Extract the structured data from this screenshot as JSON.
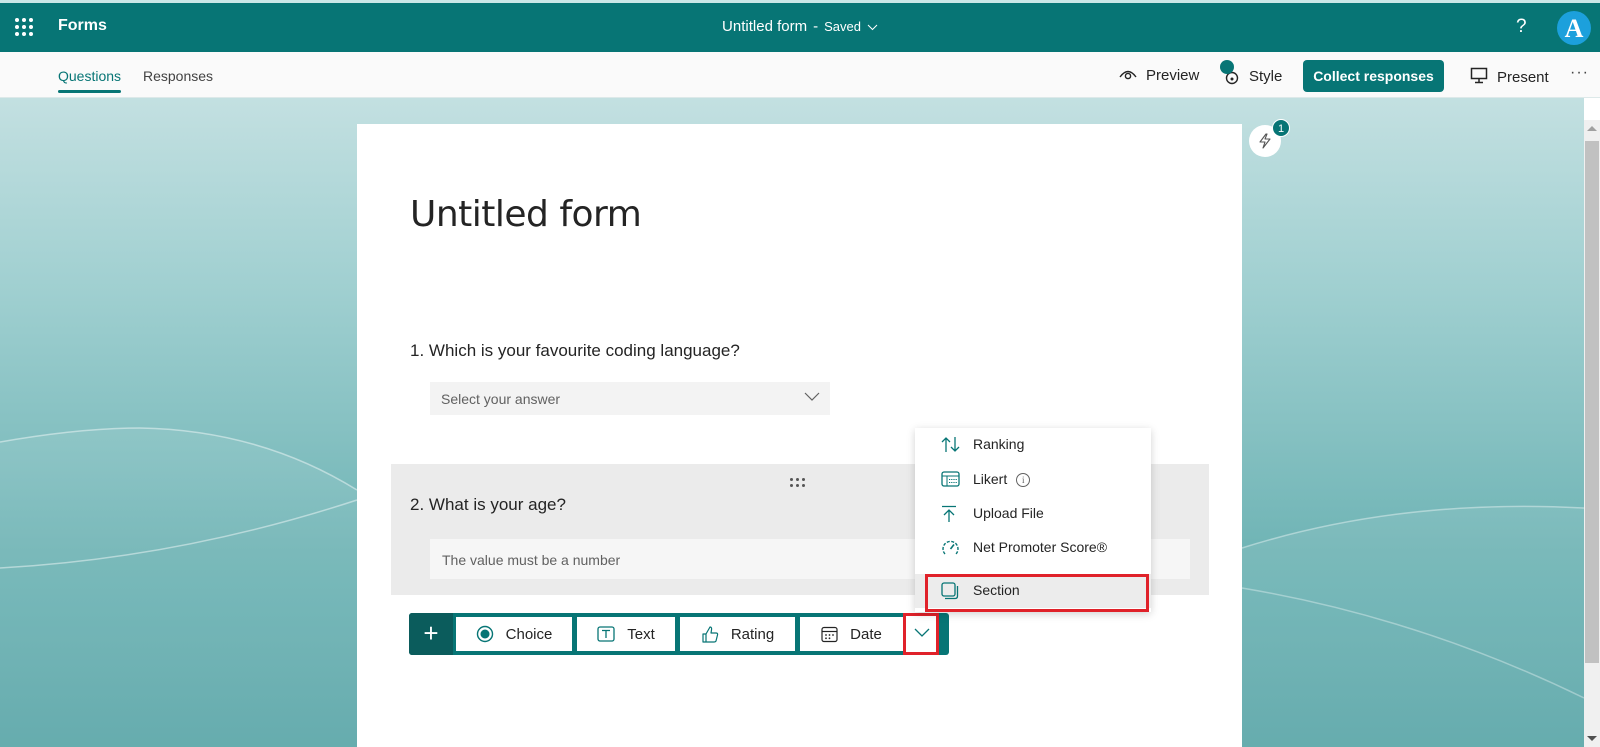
{
  "app": {
    "name": "Forms",
    "doc_title": "Untitled form",
    "separator": "-",
    "save_status": "Saved",
    "help_label": "?",
    "avatar_initial": "A"
  },
  "commandbar": {
    "tabs": [
      {
        "label": "Questions",
        "active": true
      },
      {
        "label": "Responses",
        "active": false
      }
    ],
    "preview_label": "Preview",
    "style_label": "Style",
    "collect_label": "Collect responses",
    "present_label": "Present",
    "more_label": "···"
  },
  "form": {
    "title": "Untitled form",
    "questions": [
      {
        "number": "1.",
        "text": "Which is your favourite coding language?",
        "placeholder": "Select your answer"
      },
      {
        "number": "2.",
        "text": "What is your age?",
        "placeholder": "The value must be a number"
      }
    ]
  },
  "add_toolbar": {
    "plus_label": "+",
    "types": [
      {
        "label": "Choice",
        "icon": "radio-icon"
      },
      {
        "label": "Text",
        "icon": "text-box-icon"
      },
      {
        "label": "Rating",
        "icon": "thumb-icon"
      },
      {
        "label": "Date",
        "icon": "calendar-icon"
      }
    ]
  },
  "more_types_menu": {
    "items": [
      {
        "label": "Ranking",
        "icon": "ranking-icon"
      },
      {
        "label": "Likert",
        "icon": "likert-icon",
        "info": "i"
      },
      {
        "label": "Upload File",
        "icon": "upload-icon"
      },
      {
        "label": "Net Promoter Score®",
        "icon": "gauge-icon"
      },
      {
        "label": "Section",
        "icon": "section-icon",
        "highlighted": true
      }
    ]
  },
  "ideas": {
    "badge_count": "1"
  },
  "colors": {
    "brand": "#077575",
    "highlight": "#e0222a"
  }
}
